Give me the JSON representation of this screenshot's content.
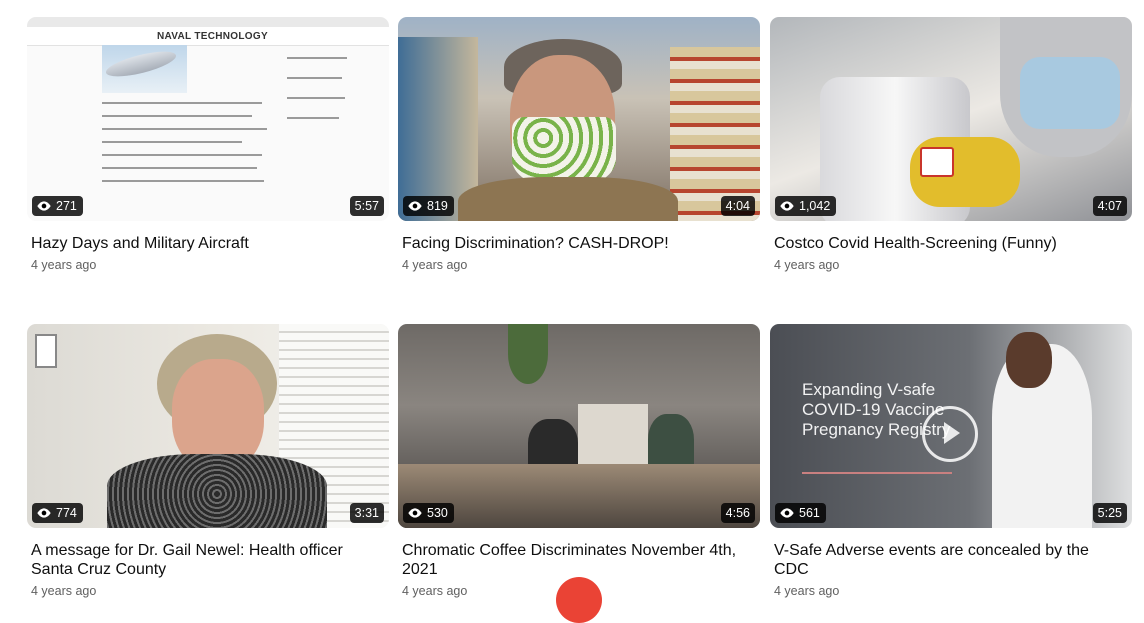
{
  "videos": [
    {
      "title": "Hazy Days and Military Aircraft",
      "age": "4 years ago",
      "views": "271",
      "duration": "5:57",
      "thumb_text": "NAVAL TECHNOLOGY"
    },
    {
      "title": "Facing Discrimination? CASH-DROP!",
      "age": "4 years ago",
      "views": "819",
      "duration": "4:04"
    },
    {
      "title": "Costco Covid Health-Screening (Funny)",
      "age": "4 years ago",
      "views": "1,042",
      "duration": "4:07"
    },
    {
      "title": "A message for Dr. Gail Newel: Health officer Santa Cruz County",
      "age": "4 years ago",
      "views": "774",
      "duration": "3:31"
    },
    {
      "title": "Chromatic Coffee Discriminates November 4th, 2021",
      "age": "4 years ago",
      "views": "530",
      "duration": "4:56"
    },
    {
      "title": "V-Safe Adverse events are concealed by the CDC",
      "age": "4 years ago",
      "views": "561",
      "duration": "5:25",
      "thumb_text": "Expanding V-safe COVID-19 Vaccine Pregnancy Registry"
    }
  ],
  "icons": {
    "views": "eye-icon",
    "play": "play-icon"
  },
  "colors": {
    "badge_bg": "#000000",
    "meta_text": "#606060",
    "fab": "#ea4335"
  }
}
